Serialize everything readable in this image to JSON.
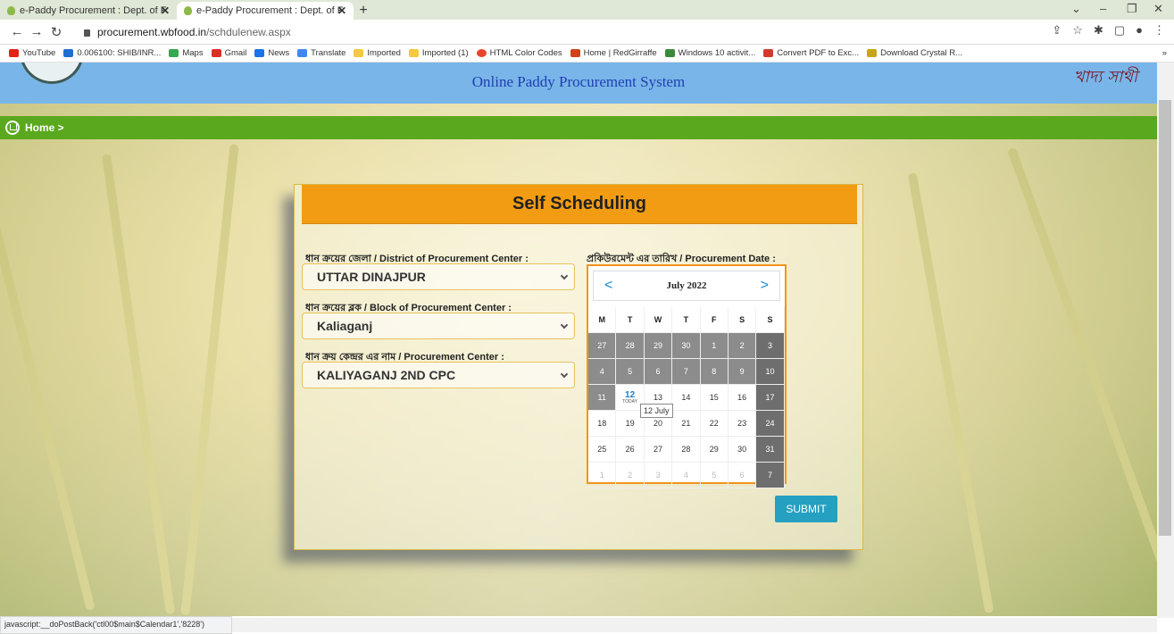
{
  "browser": {
    "tabs": [
      {
        "title": "e-Paddy Procurement : Dept. of F"
      },
      {
        "title": "e-Paddy Procurement : Dept. of F"
      }
    ],
    "url_domain": "procurement.wbfood.in",
    "url_path": "/schdulenew.aspx",
    "bookmarks": [
      {
        "label": "YouTube",
        "color": "#e62117"
      },
      {
        "label": "0.006100: SHIB/INR...",
        "color": "#1f6fd1"
      },
      {
        "label": "Maps",
        "color": "#34a853"
      },
      {
        "label": "Gmail",
        "color": "#d93025"
      },
      {
        "label": "News",
        "color": "#1a73e8"
      },
      {
        "label": "Translate",
        "color": "#4285f4"
      },
      {
        "label": "Imported",
        "color": "#f5c842"
      },
      {
        "label": "Imported (1)",
        "color": "#f5c842"
      },
      {
        "label": "HTML Color Codes",
        "color": "#e8452a"
      },
      {
        "label": "Home | RedGirraffe",
        "color": "#d0421b"
      },
      {
        "label": "Windows 10 activit...",
        "color": "#3b8a3b"
      },
      {
        "label": "Convert PDF to Exc...",
        "color": "#d33a2c"
      },
      {
        "label": "Download Crystal R...",
        "color": "#c8a517"
      }
    ],
    "status_text": "javascript:__doPostBack('ctl00$main$Calendar1','8228')"
  },
  "site": {
    "header_title": "Online Paddy Procurement System",
    "logo_right_text": "খাদ্য সাথী",
    "breadcrumb": "Home >"
  },
  "form": {
    "title": "Self Scheduling",
    "district_label": "ধান ক্রয়ের জেলা / District of Procurement Center :",
    "district_value": "UTTAR DINAJPUR",
    "block_label": "ধান ক্রয়ের ব্লক / Block of Procurement Center :",
    "block_value": "Kaliaganj",
    "center_label": "ধান ক্রয় কেন্দ্রর এর নাম / Procurement Center :",
    "center_value": "KALIYAGANJ 2ND CPC",
    "date_label": "প্রকিউরমেন্ট এর তারিখ / Procurement Date :",
    "submit_label": "SUBMIT"
  },
  "calendar": {
    "month": "July 2022",
    "prev": "<",
    "next": ">",
    "weekdays": [
      "M",
      "T",
      "W",
      "T",
      "F",
      "S",
      "S"
    ],
    "weeks": [
      [
        {
          "d": "27",
          "s": "grey"
        },
        {
          "d": "28",
          "s": "grey"
        },
        {
          "d": "29",
          "s": "grey"
        },
        {
          "d": "30",
          "s": "grey"
        },
        {
          "d": "1",
          "s": "grey"
        },
        {
          "d": "2",
          "s": "grey"
        },
        {
          "d": "3",
          "s": "sun"
        }
      ],
      [
        {
          "d": "4",
          "s": "grey"
        },
        {
          "d": "5",
          "s": "grey"
        },
        {
          "d": "6",
          "s": "grey"
        },
        {
          "d": "7",
          "s": "grey"
        },
        {
          "d": "8",
          "s": "grey"
        },
        {
          "d": "9",
          "s": "grey"
        },
        {
          "d": "10",
          "s": "sun"
        }
      ],
      [
        {
          "d": "11",
          "s": "grey"
        },
        {
          "d": "12",
          "s": "today"
        },
        {
          "d": "13",
          "s": ""
        },
        {
          "d": "14",
          "s": ""
        },
        {
          "d": "15",
          "s": ""
        },
        {
          "d": "16",
          "s": ""
        },
        {
          "d": "17",
          "s": "sun"
        }
      ],
      [
        {
          "d": "18",
          "s": ""
        },
        {
          "d": "19",
          "s": ""
        },
        {
          "d": "20",
          "s": ""
        },
        {
          "d": "21",
          "s": ""
        },
        {
          "d": "22",
          "s": ""
        },
        {
          "d": "23",
          "s": ""
        },
        {
          "d": "24",
          "s": "sun"
        }
      ],
      [
        {
          "d": "25",
          "s": ""
        },
        {
          "d": "26",
          "s": ""
        },
        {
          "d": "27",
          "s": ""
        },
        {
          "d": "28",
          "s": ""
        },
        {
          "d": "29",
          "s": ""
        },
        {
          "d": "30",
          "s": ""
        },
        {
          "d": "31",
          "s": "sun"
        }
      ],
      [
        {
          "d": "1",
          "s": "dim"
        },
        {
          "d": "2",
          "s": "dim"
        },
        {
          "d": "3",
          "s": "dim"
        },
        {
          "d": "4",
          "s": "dim"
        },
        {
          "d": "5",
          "s": "dim"
        },
        {
          "d": "6",
          "s": "dim"
        },
        {
          "d": "7",
          "s": "sun"
        }
      ]
    ],
    "today_caption": "TODAY",
    "tooltip": "12 July"
  }
}
